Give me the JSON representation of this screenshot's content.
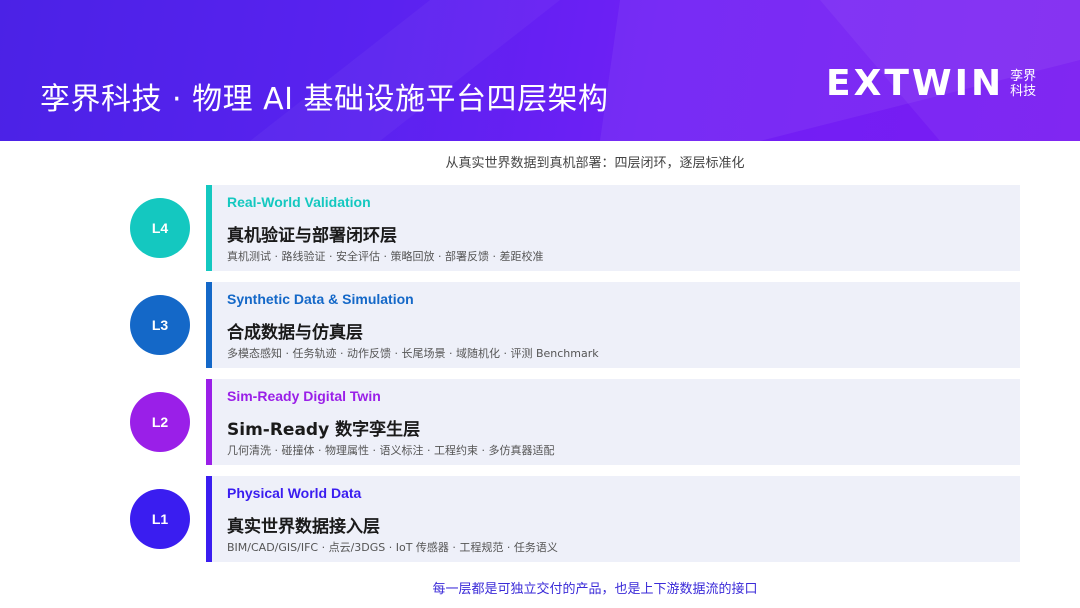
{
  "header": {
    "title": "孪界科技 · 物理 AI 基础设施平台四层架构",
    "logo_word": "EXTWIN",
    "logo_cn_top": "孪界",
    "logo_cn_bottom": "科技"
  },
  "subtitle": "从真实世界数据到真机部署：四层闭环，逐层标准化",
  "layers": [
    {
      "badge": "L4",
      "en": "Real-World Validation",
      "cn": "真机验证与部署闭环层",
      "tags": "真机测试 · 路线验证 · 安全评估 · 策略回放 · 部署反馈 · 差距校准",
      "color": "#14c8c0"
    },
    {
      "badge": "L3",
      "en": "Synthetic Data & Simulation",
      "cn": "合成数据与仿真层",
      "tags": "多模态感知 · 任务轨迹 · 动作反馈 · 长尾场景 · 域随机化 · 评测 Benchmark",
      "color": "#1468c8"
    },
    {
      "badge": "L2",
      "en": "Sim-Ready Digital Twin",
      "cn": "Sim-Ready 数字孪生层",
      "tags": "几何清洗 · 碰撞体 · 物理属性 · 语义标注 · 工程约束 · 多仿真器适配",
      "color": "#9a1fe8"
    },
    {
      "badge": "L1",
      "en": "Physical World Data",
      "cn": "真实世界数据接入层",
      "tags": "BIM/CAD/GIS/IFC · 点云/3DGS · IoT 传感器 · 工程规范 · 任务语义",
      "color": "#3a1df0"
    }
  ],
  "footer": {
    "text": "每一层都是可独立交付的产品，也是上下游数据流的接口",
    "color": "#3a2ad8"
  }
}
